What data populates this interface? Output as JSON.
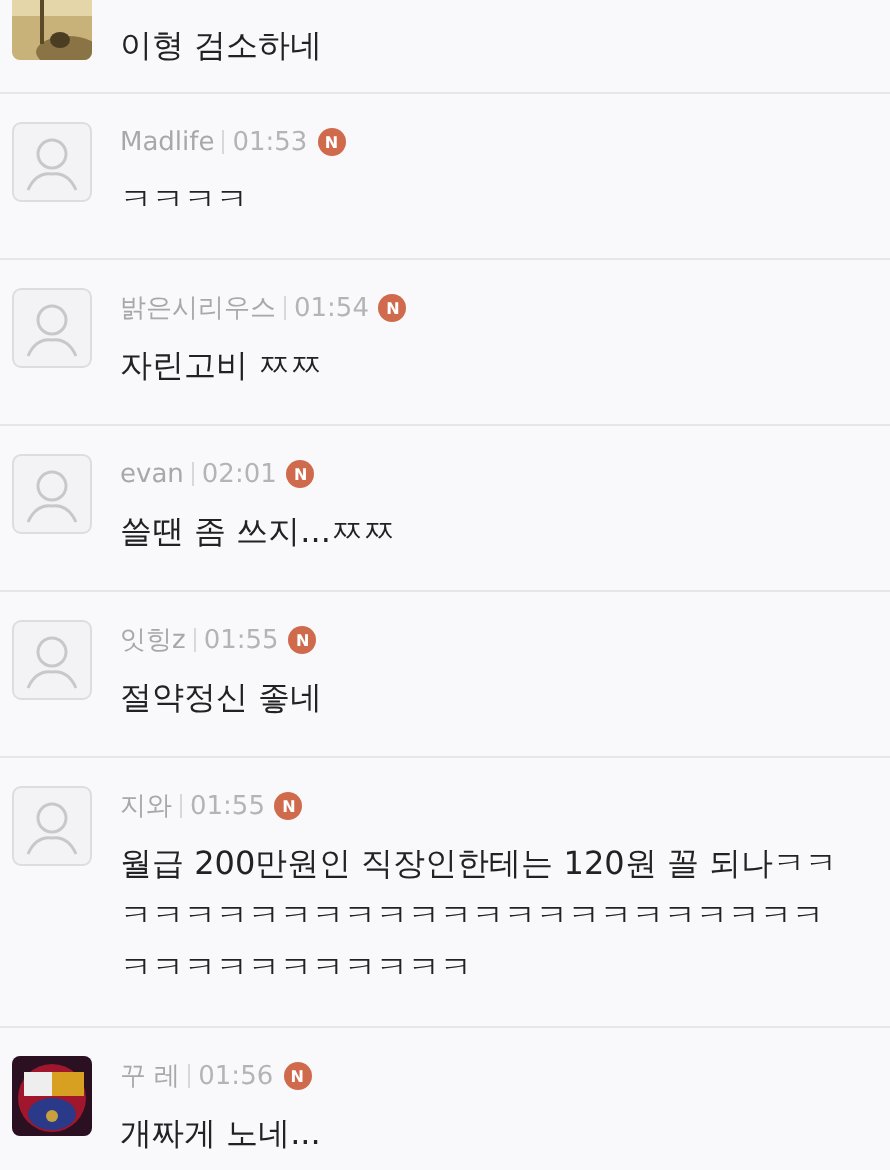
{
  "comments": [
    {
      "message": "이형 검소하네"
    },
    {
      "avatar": {
        "kind": "default"
      },
      "name": "Madlife",
      "time": "01:53",
      "badge": "N",
      "message": "ㅋㅋㅋㅋ"
    },
    {
      "avatar": {
        "kind": "default"
      },
      "name": "밝은시리우스",
      "time": "01:54",
      "badge": "N",
      "message": "자린고비 ㅉㅉ"
    },
    {
      "avatar": {
        "kind": "default"
      },
      "name": "evan",
      "time": "02:01",
      "badge": "N",
      "message": "쓸땐 좀 쓰지...ㅉㅉ"
    },
    {
      "avatar": {
        "kind": "default"
      },
      "name": "잇힝z",
      "time": "01:55",
      "badge": "N",
      "message": "절약정신 좋네"
    },
    {
      "avatar": {
        "kind": "default"
      },
      "name": "지와",
      "time": "01:55",
      "badge": "N",
      "message": "월급 200만원인 직장인한테는 120원 꼴 되나ㅋㅋㅋㅋㅋㅋㅋㅋㅋㅋㅋㅋㅋㅋㅋㅋㅋㅋㅋㅋㅋㅋㅋㅋㅋㅋㅋㅋㅋㅋㅋㅋㅋㅋㅋ"
    },
    {
      "name": "꾸 레",
      "time": "01:56",
      "badge": "N",
      "message": "개짜게 노네..."
    }
  ]
}
